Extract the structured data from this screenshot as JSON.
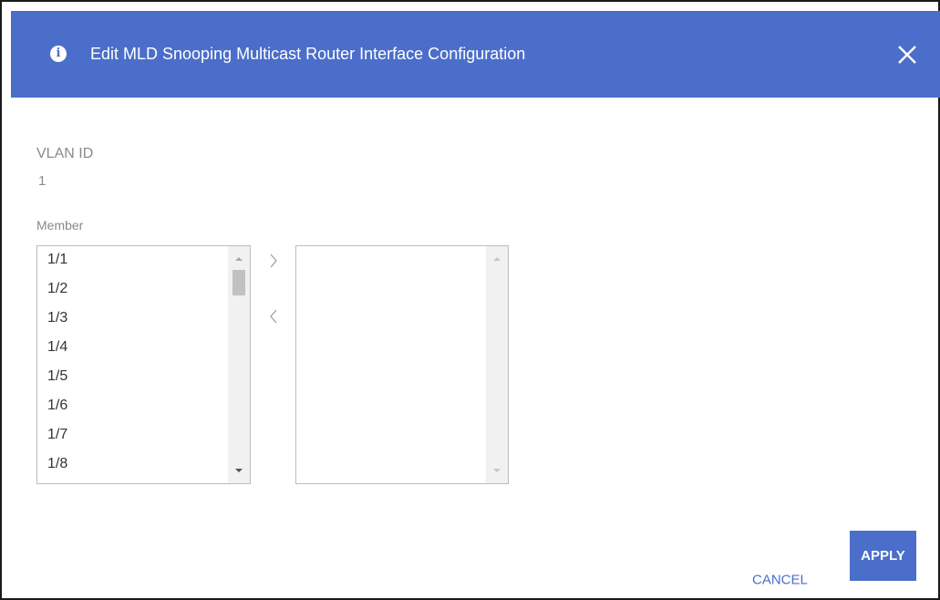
{
  "dialog": {
    "title": "Edit MLD Snooping Multicast Router Interface Configuration",
    "icons": {
      "header": "info-icon",
      "close": "close-icon"
    },
    "colors": {
      "accent": "#4a6ec9",
      "label": "#8a8a8a"
    }
  },
  "form": {
    "vlan_label": "VLAN ID",
    "vlan_value": "1",
    "member_label": "Member",
    "available_items": [
      "1/1",
      "1/2",
      "1/3",
      "1/4",
      "1/5",
      "1/6",
      "1/7",
      "1/8"
    ],
    "selected_items": []
  },
  "buttons": {
    "cancel": "CANCEL",
    "apply": "APPLY",
    "move_right_icon": "chevron-right-icon",
    "move_left_icon": "chevron-left-icon"
  }
}
